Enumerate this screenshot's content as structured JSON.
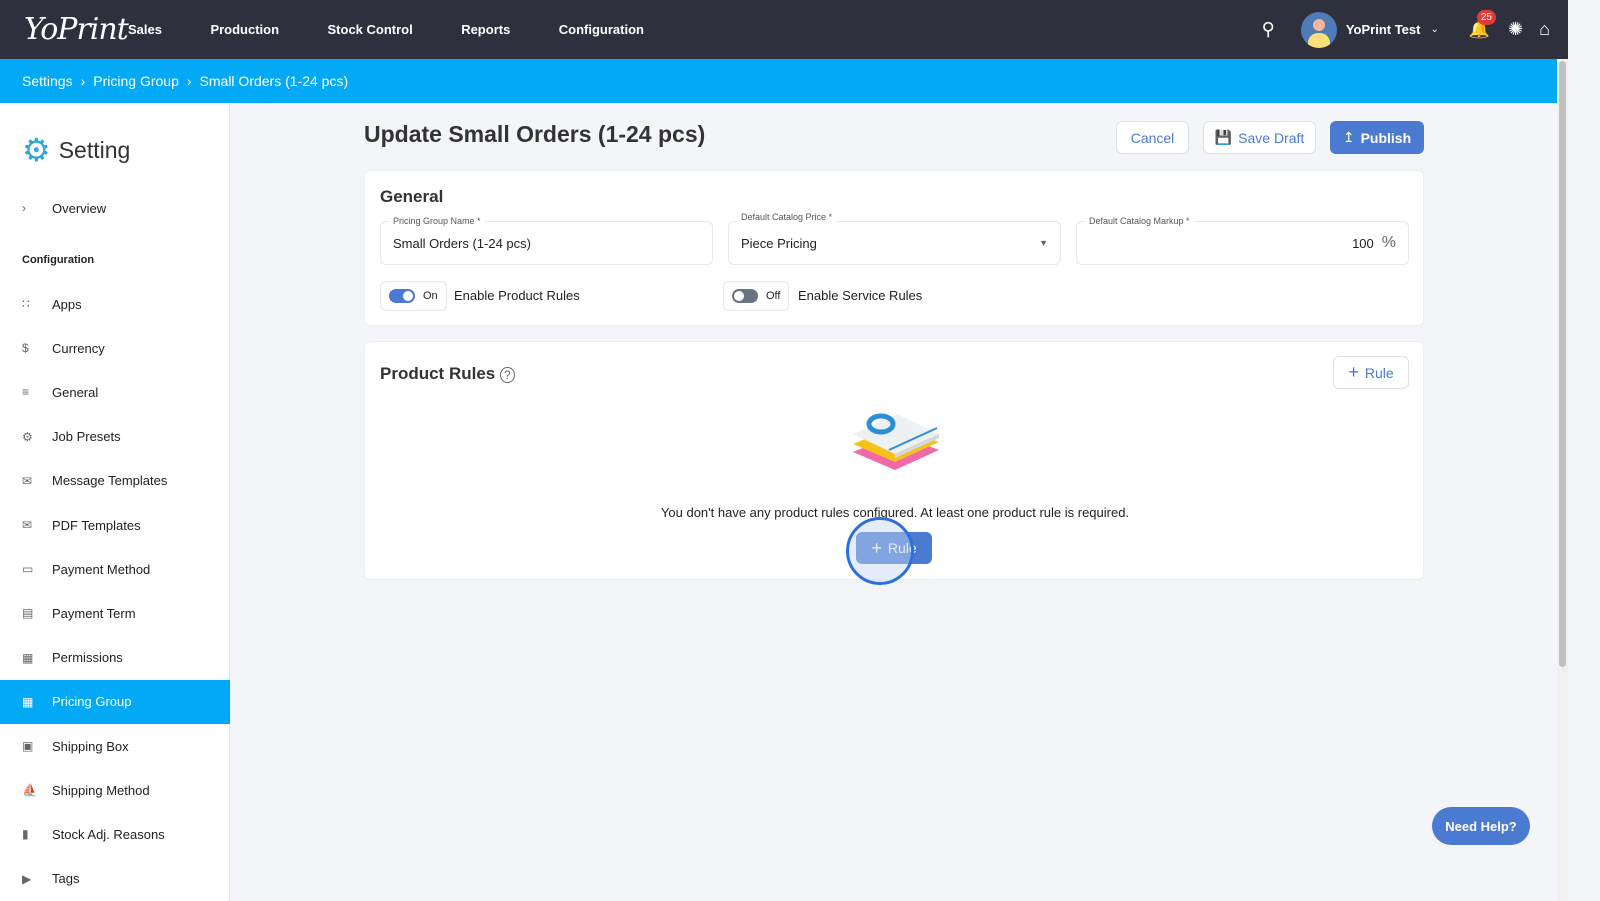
{
  "topbar": {
    "logo": "YoPrint",
    "nav": [
      "Sales",
      "Production",
      "Stock Control",
      "Reports",
      "Configuration"
    ],
    "user": "YoPrint Test",
    "notifications": "25"
  },
  "breadcrumb": [
    "Settings",
    "Pricing Group",
    "Small Orders (1-24 pcs)"
  ],
  "sidebar": {
    "title": "Setting",
    "overview": "Overview",
    "section": "Configuration",
    "items": [
      {
        "label": "Apps",
        "icon": "grid-icon"
      },
      {
        "label": "Currency",
        "icon": "dollar-icon"
      },
      {
        "label": "General",
        "icon": "sliders-icon"
      },
      {
        "label": "Job Presets",
        "icon": "gear-icon"
      },
      {
        "label": "Message Templates",
        "icon": "mail-icon"
      },
      {
        "label": "PDF Templates",
        "icon": "mail-icon"
      },
      {
        "label": "Payment Method",
        "icon": "card-icon"
      },
      {
        "label": "Payment Term",
        "icon": "clipboard-icon"
      },
      {
        "label": "Permissions",
        "icon": "list-icon"
      },
      {
        "label": "Pricing Group",
        "icon": "calendar-icon"
      },
      {
        "label": "Shipping Box",
        "icon": "box-icon"
      },
      {
        "label": "Shipping Method",
        "icon": "ship-icon"
      },
      {
        "label": "Stock Adj. Reasons",
        "icon": "comment-icon"
      },
      {
        "label": "Tags",
        "icon": "tag-icon"
      }
    ]
  },
  "page": {
    "title": "Update Small Orders (1-24 pcs)",
    "cancel": "Cancel",
    "save_draft": "Save Draft",
    "publish": "Publish"
  },
  "general": {
    "heading": "General",
    "name_label": "Pricing Group Name *",
    "name_value": "Small Orders (1-24 pcs)",
    "price_label": "Default Catalog Price *",
    "price_value": "Piece Pricing",
    "markup_label": "Default Catalog Markup *",
    "markup_value": "100",
    "markup_unit": "%",
    "product_toggle": "On",
    "product_label": "Enable Product Rules",
    "service_toggle": "Off",
    "service_label": "Enable Service Rules"
  },
  "rules": {
    "heading": "Product Rules",
    "add": "Rule",
    "empty": "You don't have any product rules configured. At least one product rule is required.",
    "add_center": "Rule"
  },
  "help": "Need Help?"
}
